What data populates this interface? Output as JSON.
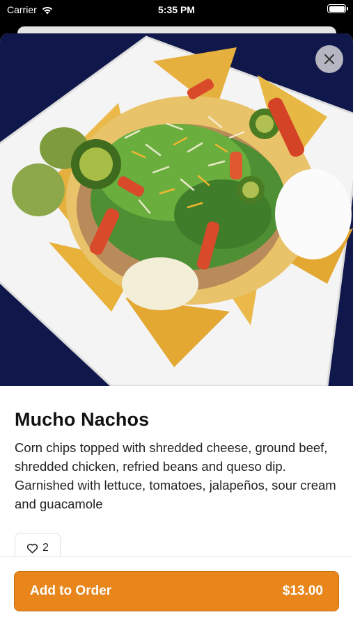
{
  "status_bar": {
    "carrier": "Carrier",
    "time": "5:35 PM"
  },
  "item": {
    "name": "Mucho Nachos",
    "description": "Corn chips topped with shredded cheese, ground beef, shredded chicken, refried beans and queso dip. Garnished with lettuce, tomatoes, jalapeños, sour cream and guacamole",
    "likes": "2"
  },
  "order_button": {
    "label": "Add to Order",
    "price": "$13.00"
  },
  "colors": {
    "accent": "#e8861c",
    "hero_background": "#10174a"
  }
}
